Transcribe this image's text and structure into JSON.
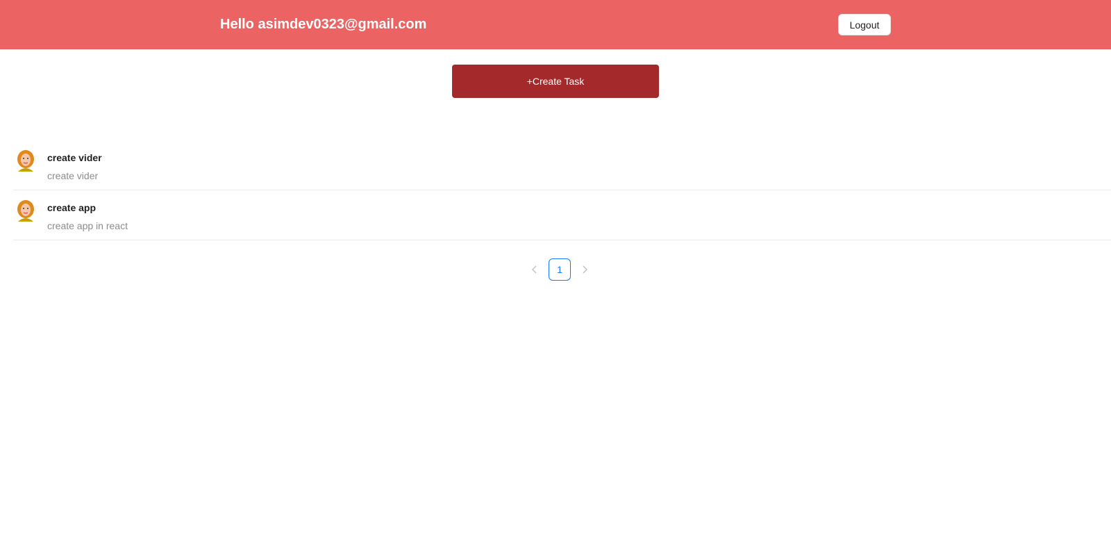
{
  "header": {
    "greeting": "Hello asimdev0323@gmail.com",
    "logout_label": "Logout",
    "background_color": "#ec6363"
  },
  "main": {
    "create_task_label": "+Create Task",
    "create_task_color": "#a4292b"
  },
  "tasks": [
    {
      "title": "create vider",
      "description": "create vider",
      "avatar_icon": "avatar-icon"
    },
    {
      "title": "create app",
      "description": "create app in react",
      "avatar_icon": "avatar-icon"
    }
  ],
  "pagination": {
    "prev_icon": "chevron-left-icon",
    "current_page": "1",
    "next_icon": "chevron-right-icon",
    "accent_color": "#1677ff"
  }
}
